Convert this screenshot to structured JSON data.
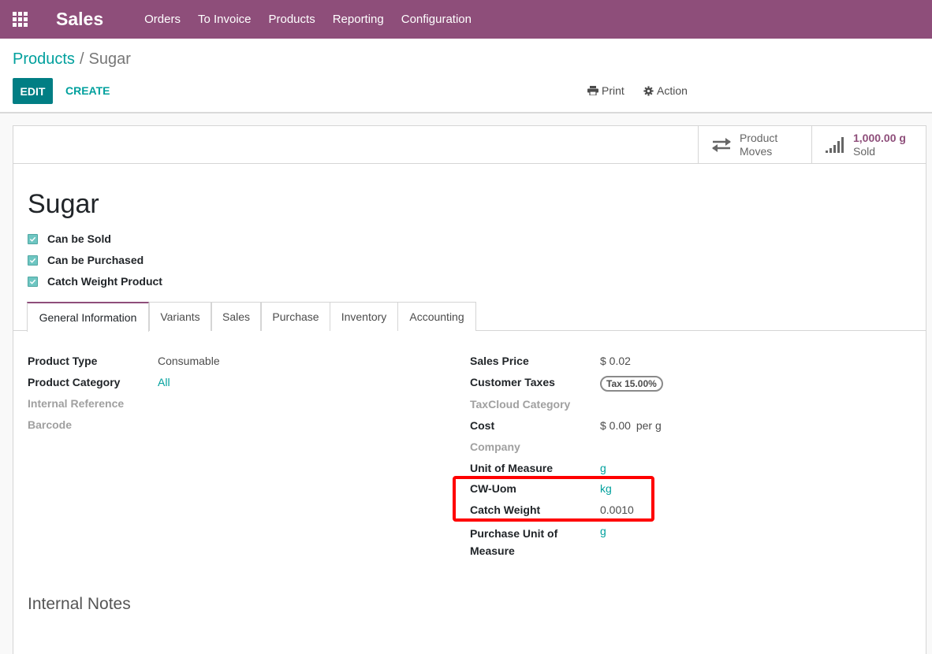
{
  "navbar": {
    "brand": "Sales",
    "menu": [
      "Orders",
      "To Invoice",
      "Products",
      "Reporting",
      "Configuration"
    ]
  },
  "breadcrumb": {
    "parent": "Products",
    "separator": "/",
    "current": "Sugar"
  },
  "toolbar": {
    "edit_label": "EDIT",
    "create_label": "CREATE",
    "print_label": "Print",
    "action_label": "Action"
  },
  "stat_buttons": {
    "moves_line1": "Product",
    "moves_line2": "Moves",
    "sold_value": "1,000.00 g",
    "sold_label": "Sold"
  },
  "product": {
    "name": "Sugar",
    "checks": [
      "Can be Sold",
      "Can be Purchased",
      "Catch Weight Product"
    ]
  },
  "tabs": [
    "General Information",
    "Variants",
    "Sales",
    "Purchase",
    "Inventory",
    "Accounting"
  ],
  "left_fields": {
    "product_type_label": "Product Type",
    "product_type_value": "Consumable",
    "category_label": "Product Category",
    "category_value": "All",
    "internal_ref_label": "Internal Reference",
    "barcode_label": "Barcode"
  },
  "right_fields": {
    "sales_price_label": "Sales Price",
    "sales_price_value": "$ 0.02",
    "customer_taxes_label": "Customer Taxes",
    "customer_taxes_value": "Tax 15.00%",
    "taxcloud_label": "TaxCloud Category",
    "cost_label": "Cost",
    "cost_value": "$ 0.00",
    "cost_unit": "per g",
    "company_label": "Company",
    "uom_label": "Unit of Measure",
    "uom_value": "g",
    "cw_uom_label": "CW-Uom",
    "cw_uom_value": "kg",
    "catch_weight_label": "Catch Weight",
    "catch_weight_value": "0.0010",
    "purchase_uom_label_1": "Purchase Unit of",
    "purchase_uom_label_2": "Measure",
    "purchase_uom_value": "g"
  },
  "notes": {
    "title": "Internal Notes"
  },
  "colors": {
    "brand": "#8e4e7a",
    "accent": "#00a09d",
    "edit_button": "#017e84",
    "highlight": "#ff0000"
  }
}
